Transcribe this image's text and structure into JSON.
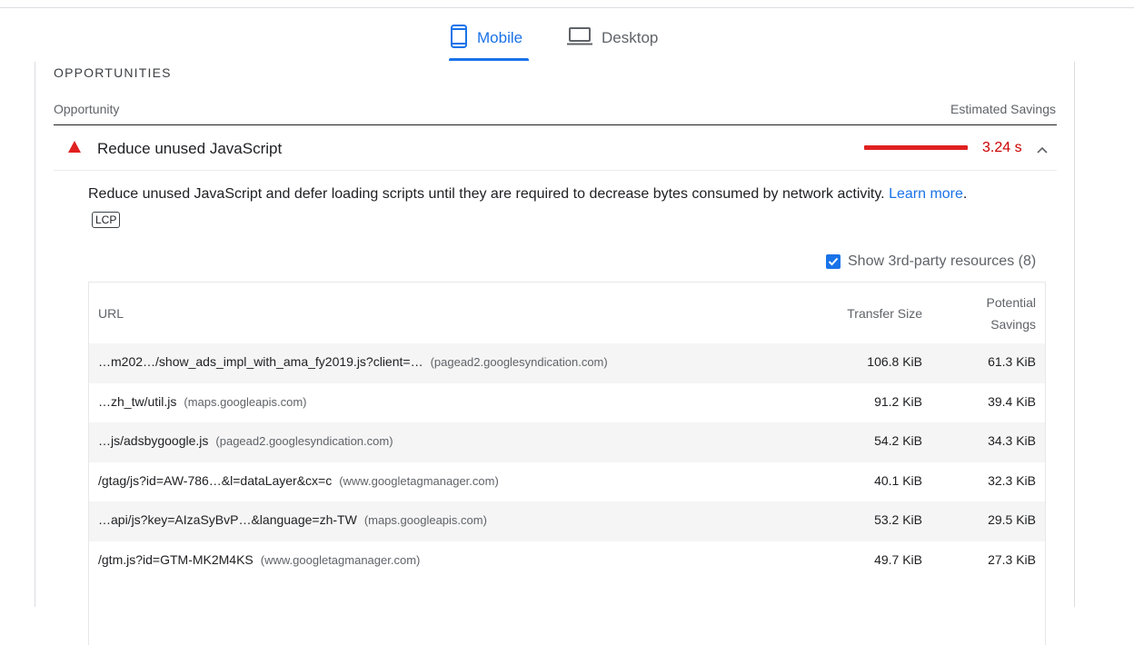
{
  "tabs": {
    "mobile_label": "Mobile",
    "desktop_label": "Desktop"
  },
  "section": {
    "title": "OPPORTUNITIES",
    "col_opportunity": "Opportunity",
    "col_estimated_savings": "Estimated Savings"
  },
  "audit": {
    "title": "Reduce unused JavaScript",
    "savings": "3.24 s",
    "description": "Reduce unused JavaScript and defer loading scripts until they are required to decrease bytes consumed by network activity.",
    "learn_more": "Learn more",
    "badge": "LCP",
    "status_color": "#e02020"
  },
  "third_party": {
    "checked": true,
    "label": "Show 3rd-party resources (8)"
  },
  "table": {
    "headers": {
      "url": "URL",
      "transfer_size": "Transfer Size",
      "potential_savings_line1": "Potential",
      "potential_savings_line2": "Savings"
    },
    "rows": [
      {
        "url": "…m202…/show_ads_impl_with_ama_fy2019.js?client=…",
        "host": "(pagead2.googlesyndication.com)",
        "transfer_size": "106.8 KiB",
        "potential_savings": "61.3 KiB"
      },
      {
        "url": "…zh_tw/util.js",
        "host": "(maps.googleapis.com)",
        "transfer_size": "91.2 KiB",
        "potential_savings": "39.4 KiB"
      },
      {
        "url": "…js/adsbygoogle.js",
        "host": "(pagead2.googlesyndication.com)",
        "transfer_size": "54.2 KiB",
        "potential_savings": "34.3 KiB"
      },
      {
        "url": "/gtag/js?id=AW-786…&l=dataLayer&cx=c",
        "host": "(www.googletagmanager.com)",
        "transfer_size": "40.1 KiB",
        "potential_savings": "32.3 KiB"
      },
      {
        "url": "…api/js?key=AIzaSyBvP…&language=zh-TW",
        "host": "(maps.googleapis.com)",
        "transfer_size": "53.2 KiB",
        "potential_savings": "29.5 KiB"
      },
      {
        "url": "/gtm.js?id=GTM-MK2M4KS",
        "host": "(www.googletagmanager.com)",
        "transfer_size": "49.7 KiB",
        "potential_savings": "27.3 KiB"
      }
    ]
  },
  "colors": {
    "accent": "#1a73e8",
    "fail": "#cc0000"
  }
}
